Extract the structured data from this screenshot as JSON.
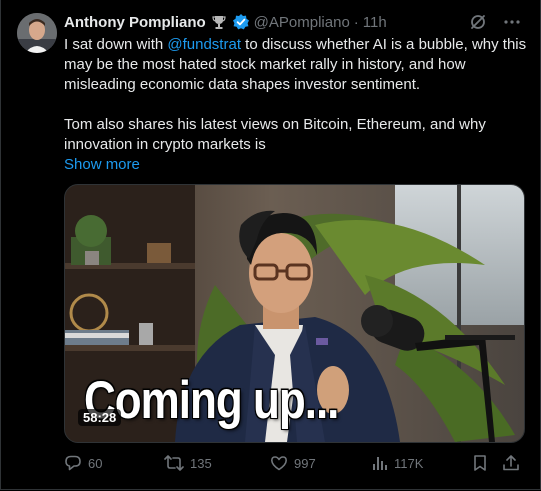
{
  "author": {
    "name": "Anthony Pompliano",
    "handle": "@APompliano",
    "separator": "·",
    "time": "11h"
  },
  "post": {
    "line1_prefix": "I sat down with ",
    "mention": "@fundstrat",
    "line1_suffix": " to discuss whether AI is a bubble, why this may be the most hated stock market rally in history, and how misleading economic data shapes investor sentiment.",
    "paragraph2": "Tom also shares his latest views on Bitcoin, Ethereum, and why innovation in crypto markets is",
    "show_more": "Show more"
  },
  "video": {
    "overlay_caption": "Coming up...",
    "duration": "58:28"
  },
  "actions": {
    "replies": "60",
    "reposts": "135",
    "likes": "997",
    "views": "117K"
  },
  "icons": {
    "badge_trophy": "trophy-icon",
    "badge_verified": "verified-badge-icon",
    "grok": "grok-icon",
    "more": "more-icon",
    "reply": "reply-icon",
    "repost": "repost-icon",
    "like": "heart-icon",
    "views": "views-icon",
    "bookmark": "bookmark-icon",
    "share": "share-icon"
  },
  "colors": {
    "background": "#000000",
    "text": "#e7e9ea",
    "muted": "#71767b",
    "accent": "#1d9bf0"
  }
}
